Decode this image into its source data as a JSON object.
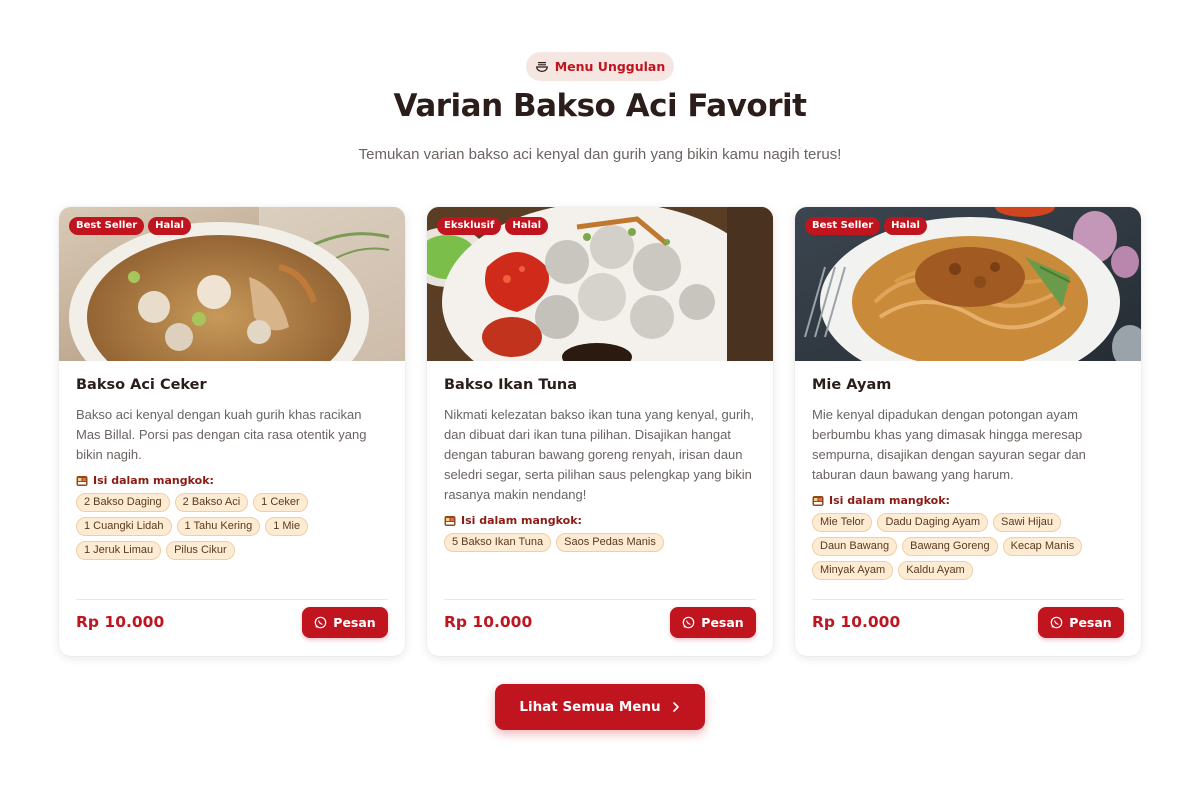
{
  "section": {
    "badge_label": "Menu Unggulan",
    "title": "Varian Bakso Aci Favorit",
    "subtitle": "Temukan varian bakso aci kenyal dan gurih yang bikin kamu nagih terus!"
  },
  "contents_label": "Isi dalam mangkok:",
  "order_label": "Pesan",
  "cards": [
    {
      "badges": [
        "Best Seller",
        "Halal"
      ],
      "name": "Bakso Aci Ceker",
      "description": "Bakso aci kenyal dengan kuah gurih khas racikan Mas Billal. Porsi pas dengan cita rasa otentik yang bikin nagih.",
      "contents": [
        "2 Bakso Daging",
        "2 Bakso Aci",
        "1 Ceker",
        "1 Cuangki Lidah",
        "1 Tahu Kering",
        "1 Mie",
        "1 Jeruk Limau",
        "Pilus Cikur"
      ],
      "price": "Rp 10.000"
    },
    {
      "badges": [
        "Eksklusif",
        "Halal"
      ],
      "name": "Bakso Ikan Tuna",
      "description": "Nikmati kelezatan bakso ikan tuna yang kenyal, gurih, dan dibuat dari ikan tuna pilihan. Disajikan hangat dengan taburan bawang goreng renyah, irisan daun seledri segar, serta pilihan saus pelengkap yang bikin rasanya makin nendang!",
      "contents": [
        "5 Bakso Ikan Tuna",
        "Saos Pedas Manis"
      ],
      "price": "Rp 10.000"
    },
    {
      "badges": [
        "Best Seller",
        "Halal"
      ],
      "name": "Mie Ayam",
      "description": "Mie kenyal dipadukan dengan potongan ayam berbumbu khas yang dimasak hingga meresap sempurna, disajikan dengan sayuran segar dan taburan daun bawang yang harum.",
      "contents": [
        "Mie Telor",
        "Dadu Daging Ayam",
        "Sawi Hijau",
        "Daun Bawang",
        "Bawang Goreng",
        "Kecap Manis",
        "Minyak Ayam",
        "Kaldu Ayam"
      ],
      "price": "Rp 10.000"
    }
  ],
  "view_all_label": "Lihat Semua Menu",
  "colors": {
    "accent": "#c0141f",
    "chip_bg": "#fdebd4",
    "title": "#2b1d1a"
  },
  "icons": {
    "section_badge": "bowl-icon",
    "contents": "bento-icon",
    "order": "whatsapp-icon",
    "view_all": "chevron-right-icon"
  }
}
